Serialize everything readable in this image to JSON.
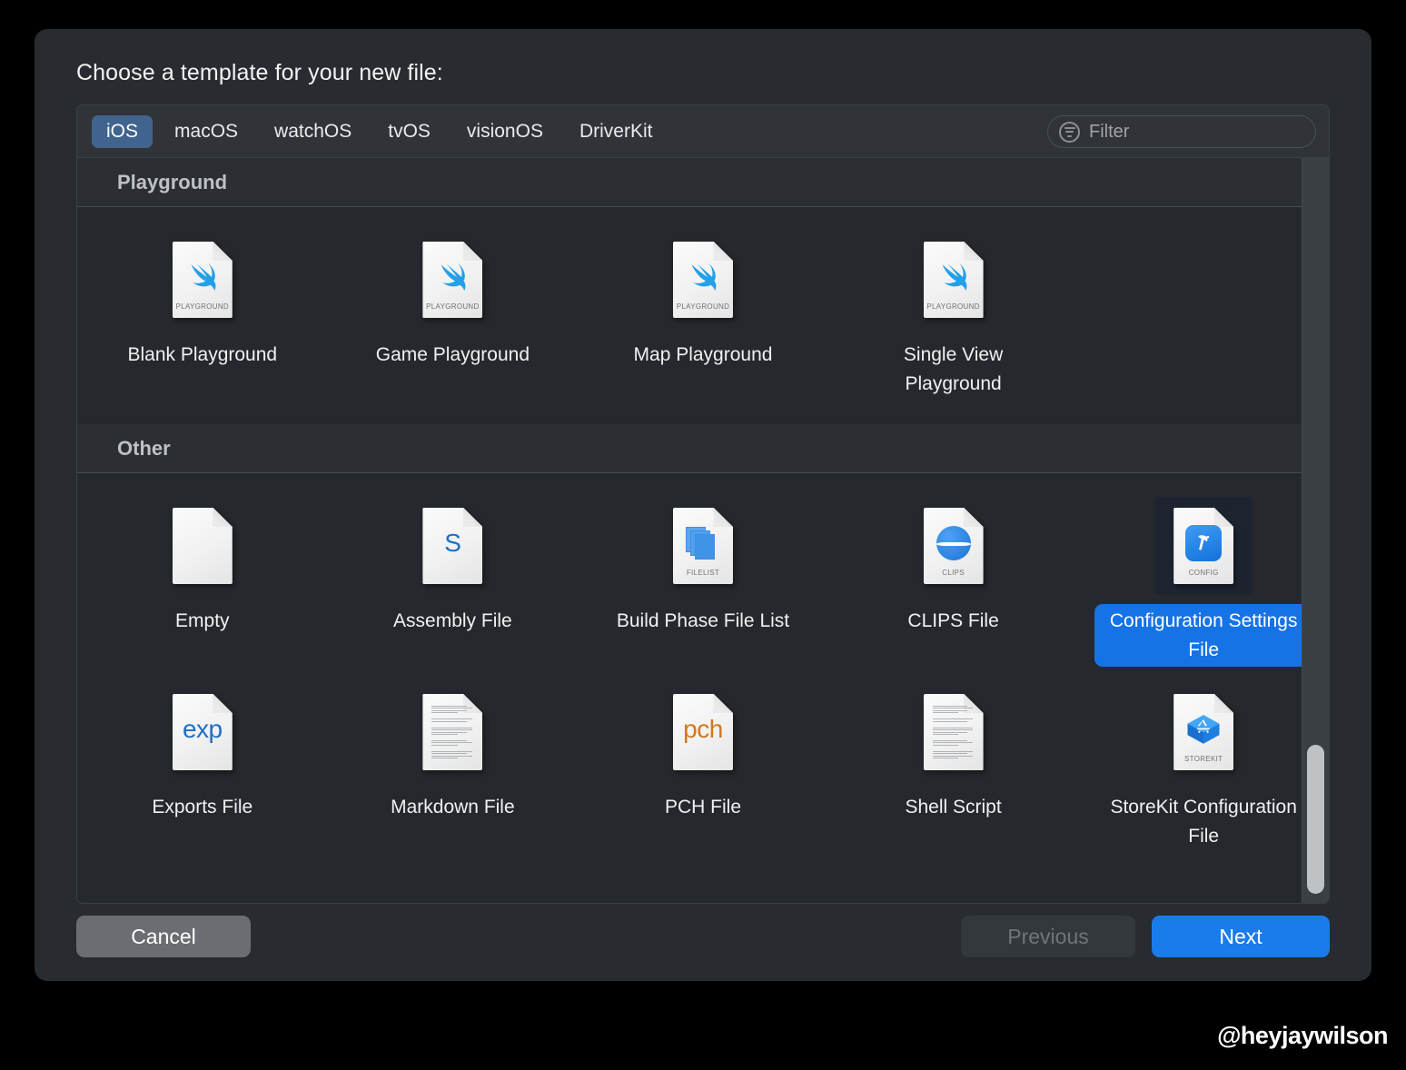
{
  "dialog": {
    "title": "Choose a template for your new file:"
  },
  "platform_tabs": [
    {
      "label": "iOS",
      "active": true
    },
    {
      "label": "macOS",
      "active": false
    },
    {
      "label": "watchOS",
      "active": false
    },
    {
      "label": "tvOS",
      "active": false
    },
    {
      "label": "visionOS",
      "active": false
    },
    {
      "label": "DriverKit",
      "active": false
    }
  ],
  "filter": {
    "placeholder": "Filter",
    "value": "",
    "icon": "filter-icon"
  },
  "sections": [
    {
      "header": "Playground",
      "items": [
        {
          "label": "Blank Playground",
          "icon": "swift-playground-icon",
          "kind": "PLAYGROUND",
          "selected": false
        },
        {
          "label": "Game Playground",
          "icon": "swift-playground-icon",
          "kind": "PLAYGROUND",
          "selected": false
        },
        {
          "label": "Map Playground",
          "icon": "swift-playground-icon",
          "kind": "PLAYGROUND",
          "selected": false
        },
        {
          "label": "Single View Playground",
          "icon": "swift-playground-icon",
          "kind": "PLAYGROUND",
          "selected": false
        }
      ]
    },
    {
      "header": "Other",
      "items": [
        {
          "label": "Empty",
          "icon": "blank-document-icon",
          "kind": "",
          "selected": false
        },
        {
          "label": "Assembly File",
          "icon": "assembly-s-icon",
          "kind": "",
          "selected": false,
          "glyph_text": "S"
        },
        {
          "label": "Build Phase File List",
          "icon": "filelist-icon",
          "kind": "FILELIST",
          "selected": false
        },
        {
          "label": "CLIPS File",
          "icon": "clips-sphere-icon",
          "kind": "CLIPS",
          "selected": false
        },
        {
          "label": "Configuration Settings File",
          "icon": "config-hammer-icon",
          "kind": "CONFIG",
          "selected": true
        },
        {
          "label": "Exports File",
          "icon": "exports-exp-icon",
          "kind": "",
          "selected": false,
          "glyph_text": "exp"
        },
        {
          "label": "Markdown File",
          "icon": "markdown-text-icon",
          "kind": "",
          "selected": false
        },
        {
          "label": "PCH File",
          "icon": "pch-icon",
          "kind": "",
          "selected": false,
          "glyph_text": "pch"
        },
        {
          "label": "Shell Script",
          "icon": "shell-script-text-icon",
          "kind": "",
          "selected": false
        },
        {
          "label": "StoreKit Configuration File",
          "icon": "storekit-cube-icon",
          "kind": "STOREKIT",
          "selected": false
        }
      ]
    }
  ],
  "footer": {
    "cancel_label": "Cancel",
    "previous_label": "Previous",
    "previous_disabled": true,
    "next_label": "Next"
  },
  "watermark": "@heyjaywilson",
  "colors": {
    "accent_blue": "#1a7ceb",
    "selection_blue": "#1573e6",
    "tab_active_blue": "#41648e",
    "window_bg": "#282c30",
    "panel_bg": "#25282c"
  }
}
